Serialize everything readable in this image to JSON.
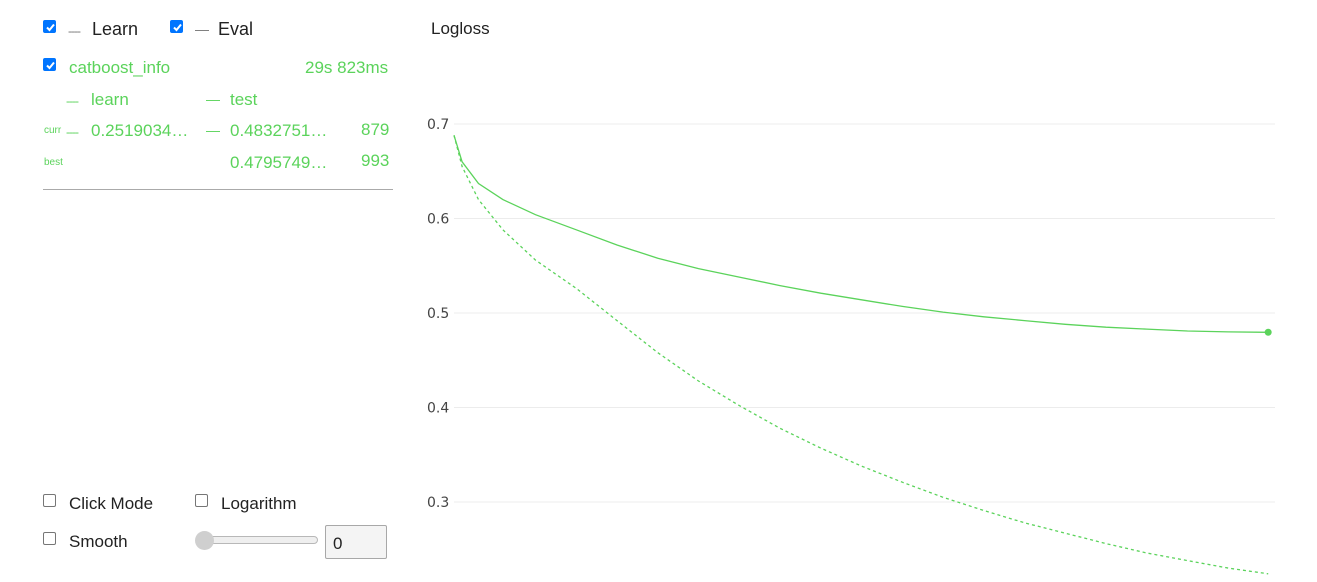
{
  "legend": {
    "learn_label": "Learn",
    "eval_label": "Eval",
    "learn_dash": "----",
    "eval_dash": "—"
  },
  "run": {
    "name": "catboost_info",
    "time": "29s 823ms",
    "col_learn": "learn",
    "col_test": "test",
    "curr_label": "curr",
    "best_label": "best",
    "curr_learn": "0.2519034…",
    "curr_test": "0.4832751…",
    "curr_iter": "879",
    "best_test": "0.4795749…",
    "best_iter": "993"
  },
  "controls": {
    "click_mode": "Click Mode",
    "logarithm": "Logarithm",
    "smooth": "Smooth",
    "smooth_value": "0"
  },
  "colors": {
    "series": "#5bd35b",
    "checkbox": "#0075ff"
  },
  "chart_data": {
    "type": "line",
    "title": "Logloss",
    "yticks": [
      0.7,
      0.6,
      0.5,
      0.4,
      0.3
    ],
    "ylim": [
      0.23,
      0.71
    ],
    "xlim": [
      0,
      1000
    ],
    "grid": true,
    "series": [
      {
        "name": "test",
        "style": "solid",
        "x": [
          0,
          10,
          30,
          60,
          100,
          150,
          200,
          250,
          300,
          350,
          400,
          450,
          500,
          550,
          600,
          650,
          700,
          750,
          800,
          850,
          900,
          950,
          999
        ],
        "y": [
          0.688,
          0.66,
          0.637,
          0.62,
          0.604,
          0.588,
          0.572,
          0.558,
          0.547,
          0.538,
          0.529,
          0.521,
          0.514,
          0.507,
          0.501,
          0.496,
          0.492,
          0.488,
          0.485,
          0.483,
          0.481,
          0.48,
          0.4796
        ]
      },
      {
        "name": "learn",
        "style": "dashed",
        "x": [
          0,
          10,
          30,
          60,
          100,
          150,
          200,
          250,
          300,
          350,
          400,
          450,
          500,
          550,
          600,
          650,
          700,
          750,
          800,
          850,
          900,
          950,
          999
        ],
        "y": [
          0.688,
          0.655,
          0.62,
          0.588,
          0.556,
          0.526,
          0.492,
          0.458,
          0.428,
          0.402,
          0.378,
          0.357,
          0.338,
          0.321,
          0.305,
          0.291,
          0.278,
          0.267,
          0.256,
          0.246,
          0.238,
          0.23,
          0.224
        ]
      }
    ]
  }
}
